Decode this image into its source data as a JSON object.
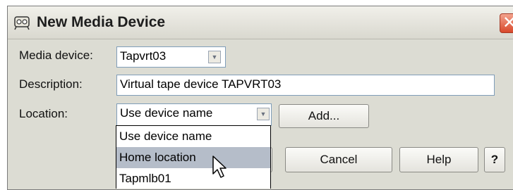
{
  "window": {
    "title": "New Media Device",
    "close_glyph": "✕"
  },
  "form": {
    "media_device": {
      "label": "Media device:",
      "value": "Tapvrt03"
    },
    "description": {
      "label": "Description:",
      "value": "Virtual tape device TAPVRT03"
    },
    "location": {
      "label": "Location:",
      "value": "Use device name"
    }
  },
  "buttons": {
    "add": "Add...",
    "cancel": "Cancel",
    "help": "Help",
    "whats_this": "?"
  },
  "location_dropdown": {
    "options": [
      "Use device name",
      "Home location",
      "Tapmlb01"
    ],
    "highlighted_index": 1
  },
  "icons": {
    "title": "media-device-icon",
    "dropdown": "chevron-down-icon",
    "pointer": "mouse-pointer-icon"
  }
}
